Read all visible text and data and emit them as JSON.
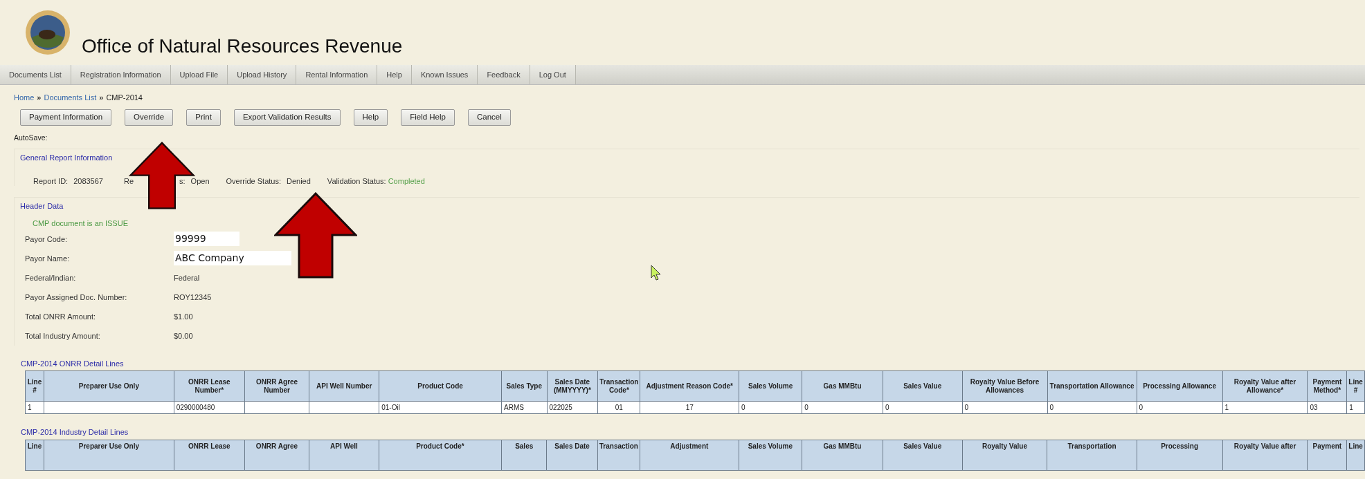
{
  "site_title": "Office of Natural Resources Revenue",
  "nav": [
    "Documents List",
    "Registration Information",
    "Upload File",
    "Upload History",
    "Rental Information",
    "Help",
    "Known Issues",
    "Feedback",
    "Log Out"
  ],
  "breadcrumb": [
    {
      "label": "Home",
      "kind": "link"
    },
    {
      "label": "Documents List",
      "kind": "link"
    },
    {
      "label": "CMP-2014",
      "kind": "current"
    }
  ],
  "breadcrumb_separator": "»",
  "buttons": [
    "Payment Information",
    "Override",
    "Print",
    "Export Validation Results",
    "Help",
    "Field Help",
    "Cancel"
  ],
  "autosave_label": "AutoSave:",
  "general_report": {
    "title": "General Report Information",
    "report_id_label": "Report ID:",
    "report_id": "2083567",
    "report_status_label_start": "Re",
    "report_status_label_end": "s:",
    "report_status": "Open",
    "override_status_label": "Override Status:",
    "override_status": "Denied",
    "validation_status_label": "Validation Status:",
    "validation_status": "Completed"
  },
  "header_data": {
    "title": "Header Data",
    "notice": "CMP document is an ISSUE",
    "fields": [
      {
        "label": "Payor Code:",
        "value": "99999",
        "kind": "input"
      },
      {
        "label": "Payor Name:",
        "value": "ABC Company",
        "kind": "input"
      },
      {
        "label": "Federal/Indian:",
        "value": "Federal",
        "kind": "text"
      },
      {
        "label": "Payor Assigned Doc. Number:",
        "value": "ROY12345",
        "kind": "text"
      },
      {
        "label": "Total ONRR Amount:",
        "value": "$1.00",
        "kind": "text"
      },
      {
        "label": "Total Industry Amount:",
        "value": "$0.00",
        "kind": "text"
      }
    ]
  },
  "onrr_table": {
    "title": "CMP-2014 ONRR Detail Lines",
    "columns": [
      "Line #",
      "Preparer Use Only",
      "ONRR Lease Number*",
      "ONRR Agree Number",
      "API Well Number",
      "Product Code",
      "Sales Type",
      "Sales Date (MMYYYY)*",
      "Transaction Code*",
      "Adjustment Reason Code*",
      "Sales Volume",
      "Gas MMBtu",
      "Sales Value",
      "Royalty Value Before Allowances",
      "Transportation Allowance",
      "Processing Allowance",
      "Royalty Value after Allowance*",
      "Payment Method*",
      "Line #"
    ],
    "rows": [
      [
        "1",
        "",
        "0290000480",
        "",
        "",
        "01-Oil",
        "ARMS",
        "022025",
        "01",
        "17",
        "0",
        "0",
        "0",
        "0",
        "0",
        "0",
        "1",
        "03",
        "1"
      ]
    ]
  },
  "industry_table": {
    "title": "CMP-2014 Industry Detail Lines",
    "columns": [
      "Line",
      "Preparer Use Only",
      "ONRR Lease",
      "ONRR Agree",
      "API Well",
      "Product Code*",
      "Sales",
      "Sales Date",
      "Transaction",
      "Adjustment",
      "Sales Volume",
      "Gas MMBtu",
      "Sales Value",
      "Royalty Value",
      "Transportation",
      "Processing",
      "Royalty Value after",
      "Payment",
      "Line"
    ]
  }
}
